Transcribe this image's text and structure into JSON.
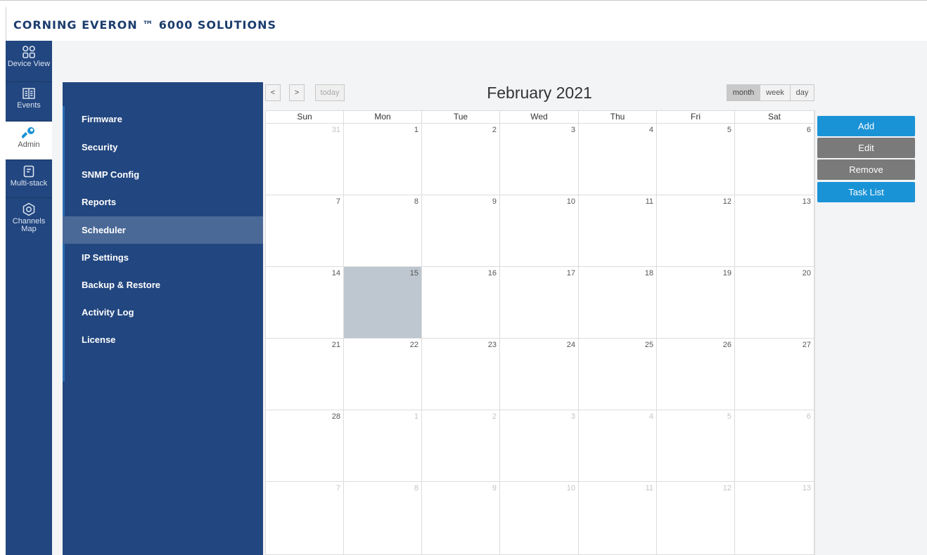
{
  "brand": "CORNING  EVERON ™ 6000 SOLUTIONS",
  "nav": [
    {
      "label": "Device View",
      "icon": "grid-icon"
    },
    {
      "label": "Events",
      "icon": "book-icon"
    },
    {
      "label": "Admin",
      "icon": "wrench-icon"
    },
    {
      "label": "Multi-stack",
      "icon": "document-icon"
    },
    {
      "label": "Channels Map",
      "icon": "hexagon-icon"
    }
  ],
  "submenu": [
    "Firmware",
    "Security",
    "SNMP Config",
    "Reports",
    "Scheduler",
    "IP Settings",
    "Backup & Restore",
    "Activity Log",
    "License"
  ],
  "calendar": {
    "prev_icon": "<",
    "next_icon": ">",
    "today_label": "today",
    "title": "February 2021",
    "views": [
      "month",
      "week",
      "day"
    ],
    "active_view": "month",
    "weekdays": [
      "Sun",
      "Mon",
      "Tue",
      "Wed",
      "Thu",
      "Fri",
      "Sat"
    ],
    "days": [
      "31",
      "1",
      "2",
      "3",
      "4",
      "5",
      "6",
      "7",
      "8",
      "9",
      "10",
      "11",
      "12",
      "13",
      "14",
      "15",
      "16",
      "17",
      "18",
      "19",
      "20",
      "21",
      "22",
      "23",
      "24",
      "25",
      "26",
      "27",
      "28",
      "1",
      "2",
      "3",
      "4",
      "5",
      "6",
      "7",
      "8",
      "9",
      "10",
      "11",
      "12",
      "13"
    ],
    "other_month_cells": [
      0,
      29,
      30,
      31,
      32,
      33,
      34,
      35,
      36,
      37,
      38,
      39,
      40,
      41
    ],
    "today_cell": 15
  },
  "actions": [
    "Add",
    "Edit",
    "Remove",
    "Task List"
  ],
  "colors": {
    "nav_bg": "#22467f",
    "accent_blue": "#1a93d6",
    "today_bg": "#bec7cf"
  }
}
